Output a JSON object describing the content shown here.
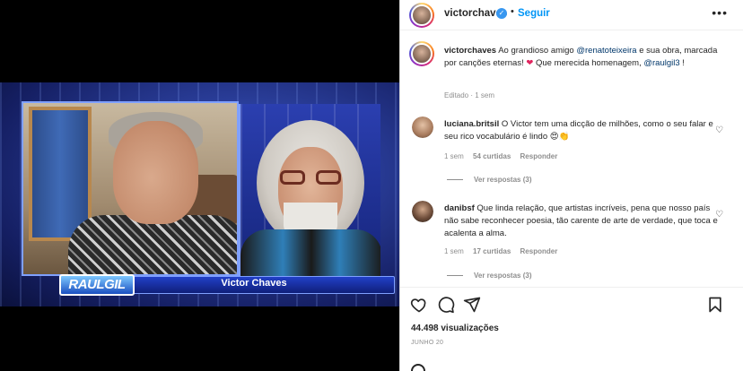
{
  "media": {
    "show_logo": "RAULGIL",
    "guest_name": "Victor Chaves"
  },
  "header": {
    "username": "victorchaves",
    "verified_glyph": "✓",
    "separator": "•",
    "follow_label": "Seguir",
    "more_label": "•••"
  },
  "caption": {
    "username": "victorchaves",
    "text_1": "Ao grandioso amigo ",
    "mention_1": "@renatoteixeira",
    "text_2": " e sua obra, marcada por canções eternas! ",
    "heart": "❤",
    "text_3": " Que merecida homenagem, ",
    "mention_2": "@raulgil3",
    "text_4": " !",
    "edited": "Editado · 1 sem"
  },
  "comments": [
    {
      "username": "luciana.britsil",
      "text": "O Victor tem uma dicção de milhões, como o seu falar e seu rico vocabulário é lindo 😍👏",
      "time": "1 sem",
      "likes": "54 curtidas",
      "reply": "Responder",
      "view_replies": "Ver respostas (3)"
    },
    {
      "username": "danibsf",
      "text": "Que linda relação, que artistas incríveis, pena que nosso país não sabe reconhecer poesia, tão carente de arte de verdade, que toca e acalenta a alma.",
      "time": "1 sem",
      "likes": "17 curtidas",
      "reply": "Responder",
      "view_replies": "Ver respostas (3)"
    }
  ],
  "stats": {
    "views": "44.498 visualizações",
    "date": "JUNHO 20"
  },
  "icons": {
    "like": "heart-icon",
    "comment": "comment-icon",
    "share": "share-icon",
    "save": "bookmark-icon"
  }
}
